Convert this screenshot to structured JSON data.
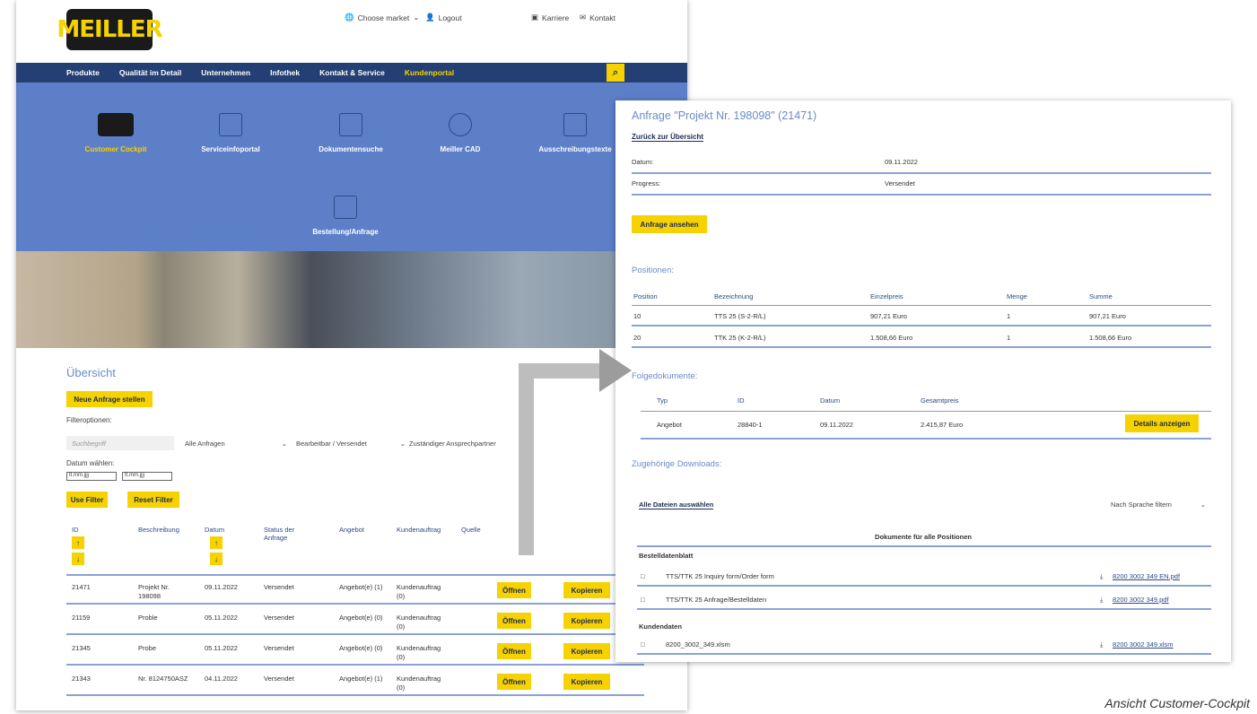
{
  "left": {
    "logo": "MEILLER",
    "top_links": {
      "market": "Choose market",
      "logout": "Logout",
      "career": "Karriere",
      "contact": "Kontakt"
    },
    "nav": [
      "Produkte",
      "Qualität im Detail",
      "Unternehmen",
      "Infothek",
      "Kontakt & Service",
      "Kundenportal"
    ],
    "hero": [
      "Customer Cockpit",
      "Serviceinfoportal",
      "Dokumentensuche",
      "Meiller CAD",
      "Ausschreibungstexte",
      "Bestellung/Anfrage"
    ],
    "overview_title": "Übersicht",
    "new_request": "Neue Anfrage stellen",
    "filter_label": "Filteroptionen:",
    "search_placeholder": "Suchbegriff",
    "filter_all": "Alle Anfragen",
    "filter_status": "Bearbeitbar / Versendet",
    "filter_contact": "Zuständiger Ansprechpartner",
    "date_label": "Datum wählen:",
    "date_placeholder": "tt.mm.jjjj",
    "use_filter": "Use Filter",
    "reset_filter": "Reset Filter",
    "headers": {
      "id": "ID",
      "desc": "Beschreibung",
      "date": "Datum",
      "status": "Status der Anfrage",
      "offer": "Angebot",
      "order": "Kundenauftrag",
      "source": "Quelle"
    },
    "sort_up": "↑",
    "sort_down": "↓",
    "open": "Öffnen",
    "copy": "Kopieren",
    "rows": [
      {
        "id": "21471",
        "desc": "Projekt Nr. 198098",
        "date": "09.11.2022",
        "status": "Versendet",
        "offer": "Angebot(e) (1)",
        "order": "Kundenauftrag (0)"
      },
      {
        "id": "21159",
        "desc": "Proble",
        "date": "05.11.2022",
        "status": "Versendet",
        "offer": "Angebot(e) (0)",
        "order": "Kundenauftrag (0)"
      },
      {
        "id": "21345",
        "desc": "Probe",
        "date": "05.11.2022",
        "status": "Versendet",
        "offer": "Angebot(e) (0)",
        "order": "Kundenauftrag (0)"
      },
      {
        "id": "21343",
        "desc": "Nr. 8124750ASZ",
        "date": "04.11.2022",
        "status": "Versendet",
        "offer": "Angebot(e) (1)",
        "order": "Kundenauftrag (0)"
      }
    ]
  },
  "right": {
    "title": "Anfrage \"Projekt Nr. 198098\" (21471)",
    "back": "Zurück zur Übersicht",
    "date_label": "Datum:",
    "date_value": "09.11.2022",
    "progress_label": "Progress:",
    "progress_value": "Versendet",
    "view_request": "Anfrage ansehen",
    "positions_title": "Positionen:",
    "pos_headers": {
      "pos": "Position",
      "name": "Bezeichnung",
      "price": "Einzelpreis",
      "qty": "Menge",
      "sum": "Summe"
    },
    "positions": [
      {
        "pos": "10",
        "name": "TTS 25 (S-2-R/L)",
        "price": "907,21 Euro",
        "qty": "1",
        "sum": "907,21 Euro"
      },
      {
        "pos": "20",
        "name": "TTK 25 (K-2-R/L)",
        "price": "1.508,66 Euro",
        "qty": "1",
        "sum": "1.508,66 Euro"
      }
    ],
    "follow_title": "Folgedokumente:",
    "follow_headers": {
      "type": "Typ",
      "id": "ID",
      "date": "Datum",
      "total": "Gesamtpreis"
    },
    "follow_row": {
      "type": "Angebot",
      "id": "28840-1",
      "date": "09.11.2022",
      "total": "2.415,87 Euro"
    },
    "details": "Details anzeigen",
    "downloads_title": "Zugehörige Downloads:",
    "select_all": "Alle Dateien auswählen",
    "lang_filter": "Nach Sprache filtern",
    "docs_heading": "Dokumente für alle Positionen",
    "group1": "Bestelldatenblatt",
    "files1": [
      {
        "name": "TTS/TTK 25 Inquiry form/Order form",
        "link": "8200 3002 349 EN.pdf"
      },
      {
        "name": "TTS/TTK 25 Anfrage/Bestelldaten",
        "link": "8200 3002 349.pdf"
      }
    ],
    "group2": "Kundendaten",
    "files2": [
      {
        "name": "8200_3002_349.xlsm",
        "link": "8200 3002 349.xlsm"
      }
    ]
  },
  "caption": "Ansicht Customer-Cockpit",
  "colors": {
    "accent": "#f5d200",
    "navy": "#243f73",
    "hero": "#5c7fc8",
    "title_blue": "#6a8bc9"
  }
}
